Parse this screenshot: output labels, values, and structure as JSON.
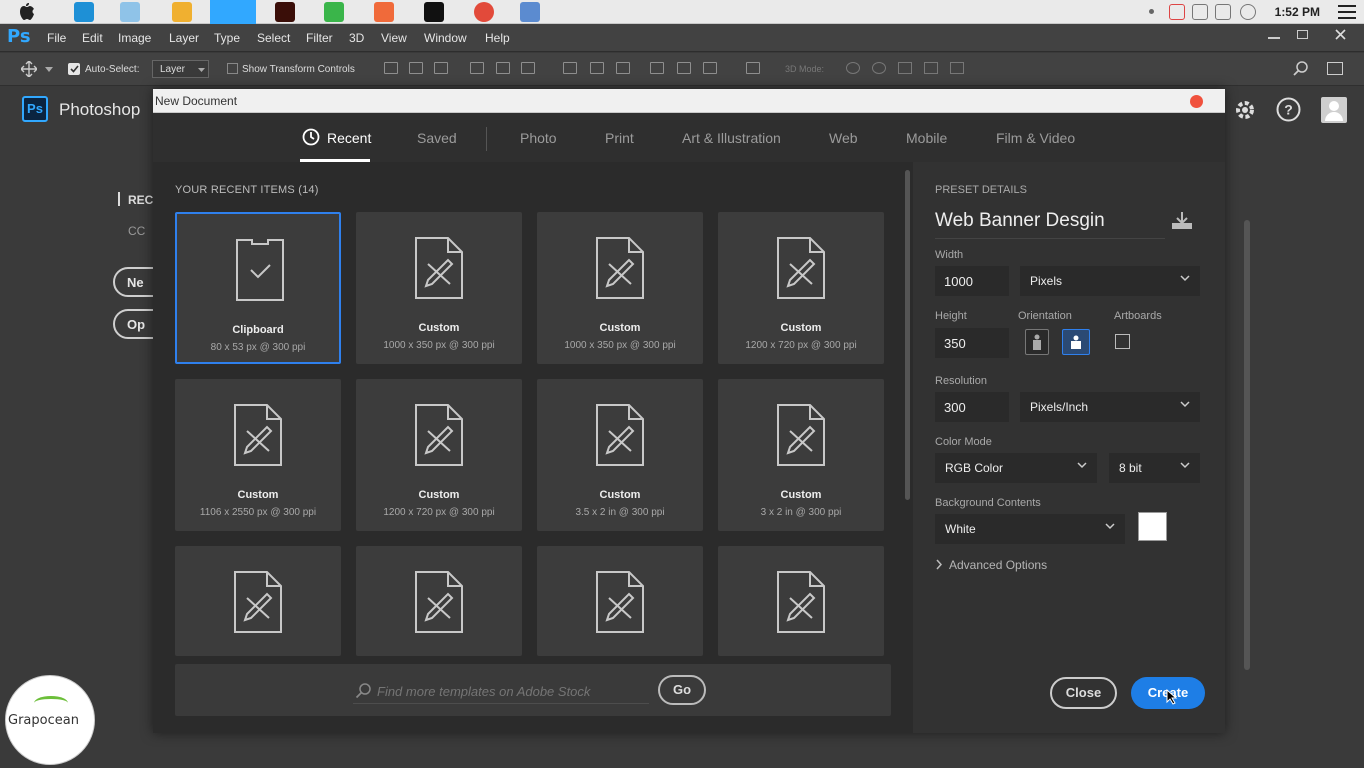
{
  "macbar": {
    "clock": "1:52 PM"
  },
  "menubar": {
    "app_logo": "Ps",
    "items": [
      "File",
      "Edit",
      "Image",
      "Layer",
      "Type",
      "Select",
      "Filter",
      "3D",
      "View",
      "Window",
      "Help"
    ]
  },
  "options_bar": {
    "auto_select_label": "Auto-Select:",
    "auto_select_checked": true,
    "auto_select_target": "Layer",
    "show_transform_label": "Show Transform Controls",
    "mode_3d_label": "3D Mode:"
  },
  "home": {
    "app_icon_text": "Ps",
    "app_name": "Photoshop",
    "recent_partial": "REC",
    "cc_partial": "CC",
    "new_partial": "Ne",
    "open_partial": "Op"
  },
  "dialog": {
    "title": "New Document",
    "tabs": [
      {
        "label": "Recent",
        "active": true
      },
      {
        "label": "Saved",
        "active": false
      },
      {
        "label": "Photo",
        "active": false
      },
      {
        "label": "Print",
        "active": false
      },
      {
        "label": "Art & Illustration",
        "active": false
      },
      {
        "label": "Web",
        "active": false
      },
      {
        "label": "Mobile",
        "active": false
      },
      {
        "label": "Film & Video",
        "active": false
      }
    ],
    "recent_heading": "YOUR RECENT ITEMS",
    "recent_count": "(14)",
    "tiles": [
      {
        "name": "Clipboard",
        "size": "80 x 53 px @ 300 ppi",
        "selected": true,
        "icon": "clipboard-check-icon"
      },
      {
        "name": "Custom",
        "size": "1000 x 350 px @ 300 ppi",
        "selected": false,
        "icon": "document-pencil-icon"
      },
      {
        "name": "Custom",
        "size": "1000 x 350 px @ 300 ppi",
        "selected": false,
        "icon": "document-pencil-icon"
      },
      {
        "name": "Custom",
        "size": "1200 x 720 px @ 300 ppi",
        "selected": false,
        "icon": "document-pencil-icon"
      },
      {
        "name": "Custom",
        "size": "1106 x 2550 px @ 300 ppi",
        "selected": false,
        "icon": "document-pencil-icon"
      },
      {
        "name": "Custom",
        "size": "1200 x 720 px @ 300 ppi",
        "selected": false,
        "icon": "document-pencil-icon"
      },
      {
        "name": "Custom",
        "size": "3.5 x 2 in @ 300 ppi",
        "selected": false,
        "icon": "document-pencil-icon"
      },
      {
        "name": "Custom",
        "size": "3 x 2 in @ 300 ppi",
        "selected": false,
        "icon": "document-pencil-icon"
      },
      {
        "name": "",
        "size": "",
        "selected": false,
        "icon": "document-pencil-icon"
      },
      {
        "name": "",
        "size": "",
        "selected": false,
        "icon": "document-pencil-icon"
      },
      {
        "name": "",
        "size": "",
        "selected": false,
        "icon": "document-pencil-icon"
      },
      {
        "name": "",
        "size": "",
        "selected": false,
        "icon": "document-pencil-icon"
      }
    ],
    "search_placeholder": "Find more templates on Adobe Stock",
    "go_label": "Go",
    "preset": {
      "heading": "PRESET DETAILS",
      "name": "Web Banner Desgin",
      "width_label": "Width",
      "width_value": "1000",
      "width_unit": "Pixels",
      "height_label": "Height",
      "height_value": "350",
      "orientation_label": "Orientation",
      "orientation_selected": "landscape",
      "artboards_label": "Artboards",
      "artboards_checked": false,
      "resolution_label": "Resolution",
      "resolution_value": "300",
      "resolution_unit": "Pixels/Inch",
      "color_mode_label": "Color Mode",
      "color_mode": "RGB Color",
      "bit_depth": "8 bit",
      "bg_label": "Background Contents",
      "bg_value": "White",
      "bg_color": "#ffffff",
      "advanced_label": "Advanced Options",
      "close_label": "Close",
      "create_label": "Create"
    }
  },
  "watermark": {
    "text": "Grapocean"
  },
  "colors": {
    "accent": "#1e7ee6",
    "ps_blue": "#31a8ff",
    "close_dot": "#f0513d"
  }
}
